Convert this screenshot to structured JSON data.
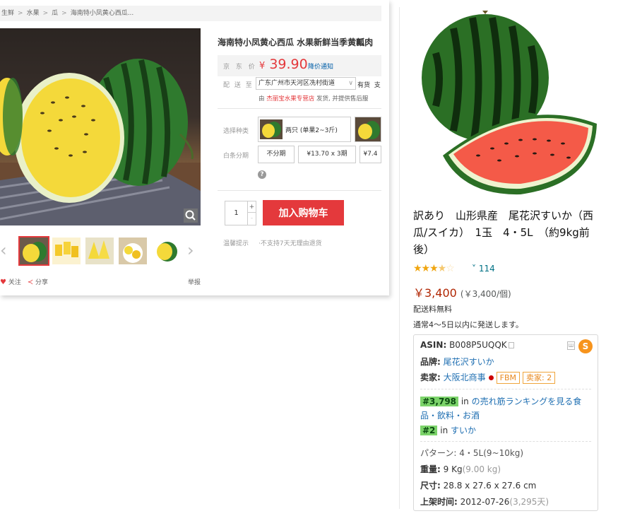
{
  "jd": {
    "breadcrumb": [
      "生鲜",
      "水果",
      "瓜",
      "海南特小凤黄心西瓜..."
    ],
    "title": "海南特小凤黄心西瓜 水果新鲜当季黄瓤肉",
    "price_label": "京 东 价",
    "price_symbol": "¥",
    "price_value": "39.90",
    "price_notify": "降价通知",
    "ship_label": "配 送 至",
    "ship_address": "广东广州市天河区冼村街道",
    "stock": "有货",
    "stock_extra": "支",
    "seller_prefix": "由",
    "seller_shop": "杰丽宝水果专营店",
    "seller_suffix": "发货, 并提供售后服",
    "variant_label": "选择种类",
    "variant_option": "两只 (单果2~3斤)",
    "installment_label": "白条分期",
    "installments": [
      "不分期",
      "¥13.70 x 3期",
      "¥7.4"
    ],
    "help_icon": "?",
    "quantity": "1",
    "qty_plus": "+",
    "qty_minus": "-",
    "add_to_cart": "加入购物车",
    "tip_label": "温馨提示",
    "tip_text": "·不支持7天无理由退货",
    "follow": "关注",
    "share": "分享",
    "report": "举报",
    "arrow_prev": "‹",
    "arrow_next": "›"
  },
  "amazon": {
    "title": "訳あり　山形県産　尾花沢すいか（西瓜/スイカ）　1玉　4・5L　（約9kg前後）",
    "rating_stars": 3.5,
    "stars_full": "★★★",
    "stars_half": "★",
    "stars_empty": "☆",
    "review_chevron": "˅",
    "review_count": "114",
    "price": "￥3,400",
    "price_unit": "(￥3,400/個)",
    "free_shipping": "配送料無料",
    "ship_time": "通常4～5日以内に発送します。",
    "asin_label": "ASIN:",
    "asin": "B008P5UQQK",
    "brand_label": "品牌:",
    "brand": "尾花沢すいか",
    "seller_label": "卖家:",
    "seller": "大阪北商事",
    "fbm": "FBM",
    "seller_count": "卖家: 2",
    "rank1": "#3,798",
    "rank1_in": "in",
    "rank1_cat": "の売れ筋ランキングを見る食品・飲料・お酒",
    "rank2": "#2",
    "rank2_in": "in",
    "rank2_cat": "すいか",
    "pattern": "パターン: 4・5L(9~10kg)",
    "weight_label": "重量:",
    "weight": "9 Kg",
    "weight_alt": "(9.00 kg)",
    "size_label": "尺寸:",
    "size": "28.8 x 27.6 x 27.6 cm",
    "listed_label": "上架时间:",
    "listed": "2012-07-26",
    "listed_days": "(3,295天)",
    "badge": "S",
    "badge2": "Ш"
  },
  "colors": {
    "jd_red": "#e4393c",
    "amazon_price": "#b12704",
    "link": "#1f6fb2",
    "star": "#f0a50f",
    "rank_green": "#7cd36a"
  }
}
